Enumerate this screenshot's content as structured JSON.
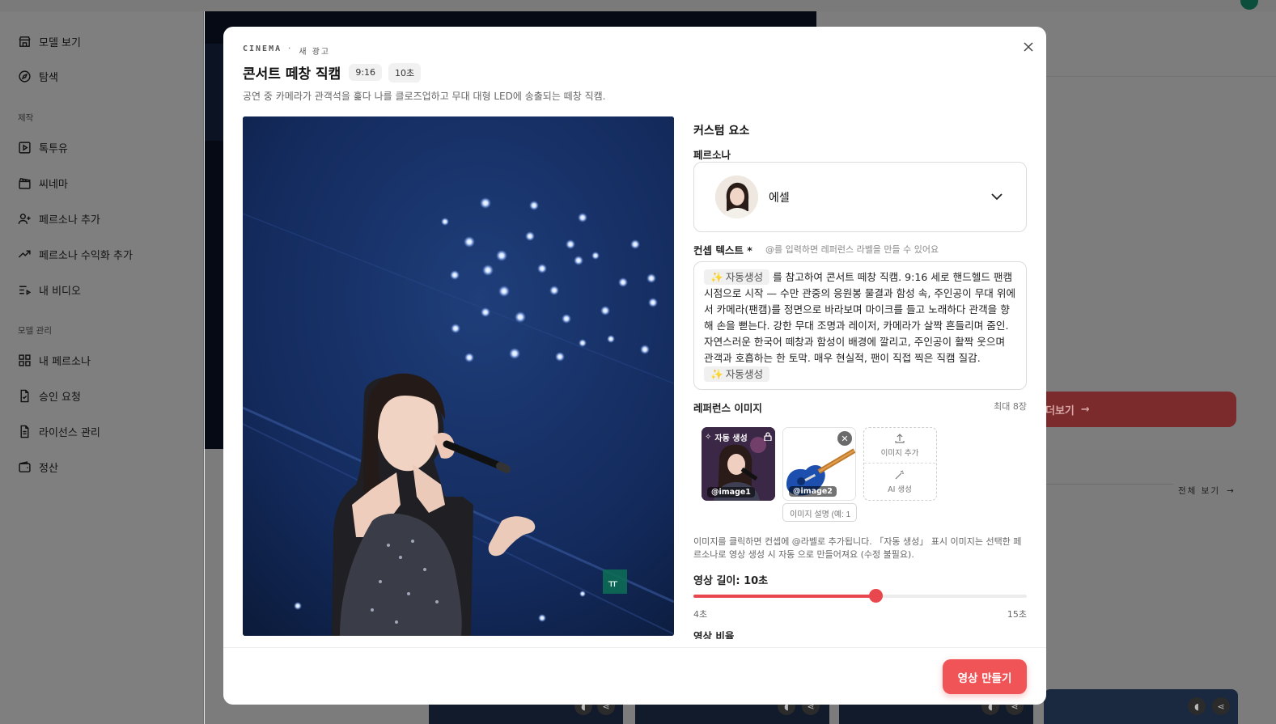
{
  "sidebar": {
    "items": [
      {
        "label": "모델 보기",
        "icon": "store-icon"
      },
      {
        "label": "탐색",
        "icon": "compass-icon"
      },
      {
        "label": "톡투유",
        "icon": "play-square-icon"
      },
      {
        "label": "씨네마",
        "icon": "clapperboard-icon"
      },
      {
        "label": "페르소나 추가",
        "icon": "user-plus-icon"
      },
      {
        "label": "페르소나 수익화 추가",
        "icon": "trending-up-icon"
      },
      {
        "label": "내 비디오",
        "icon": "list-video-icon"
      },
      {
        "label": "내 페르소나",
        "icon": "grid-icon"
      },
      {
        "label": "승인 요청",
        "icon": "file-check-icon"
      },
      {
        "label": "라이선스 관리",
        "icon": "file-text-icon"
      },
      {
        "label": "정산",
        "icon": "wallet-icon"
      }
    ],
    "sections": {
      "create": "제작",
      "model_mgmt": "모델 관리"
    }
  },
  "background": {
    "cta_label": "더보기",
    "see_all": "전체 보기"
  },
  "modal": {
    "eyebrow_category": "CINEMA",
    "eyebrow_sep": "·",
    "eyebrow_sub": "새 광고",
    "title": "콘서트 떼창 직캠",
    "ratio_chip": "9:16",
    "duration_chip": "10초",
    "description": "공연 중 카메라가 관객석을 훑다 나를 클로즈업하고 무대 대형 LED에 송출되는 떼창 직캠.",
    "close_icon": "close-icon"
  },
  "form": {
    "section_title": "커스텀 요소",
    "persona_label": "페르소나",
    "persona_name": "에셀",
    "concept_label": "컨셉 텍스트 *",
    "concept_hint": "@를 입력하면 레퍼런스 라벨을 만들 수 있어요",
    "auto_token": "자동생성",
    "concept_text": "를 참고하여 콘서트 떼창 직캠. 9:16 세로 핸드헬드 팬캠 시점으로 시작 — 수만 관중의 응원봉 물결과 함성 속, 주인공이 무대 위에서 카메라(팬캠)를 정면으로 바라보며 마이크를 들고 노래하다 관객을 향해 손을 뻗는다. 강한 무대 조명과 레이저, 카메라가 살짝 흔들리며 줌인. 자연스러운 한국어 떼창과 함성이 배경에 깔리고, 주인공이 활짝 웃으며 관객과 호흡하는 한 토막. 매우 현실적, 팬이 직접 찍은 직캠 질감.",
    "ref_label": "레퍼런스 이미지",
    "ref_max": "최대 8장",
    "ref_images": [
      {
        "label": "@image1",
        "badge": "자동 생성"
      },
      {
        "label": "@image2"
      }
    ],
    "add_image": "이미지 추가",
    "ai_generate": "AI 생성",
    "img_desc_placeholder": "이미지 설명 (예: 1",
    "note": "이미지를 클릭하면 컨셉에 @라벨로 추가됩니다. 「자동 생성」 표시 이미지는 선택한 페르소나로 영상 생성 시 자동 으로 만들어져요 (수정 불필요).",
    "length_label": "영상 길이: 10초",
    "length_min": "4초",
    "length_max": "15초",
    "length_value": 10,
    "length_range": [
      4,
      15
    ],
    "ratio_label": "영상 비율"
  },
  "footer": {
    "make_button": "영상 만들기"
  },
  "colors": {
    "accent": "#f05457",
    "slider": "#e8484d"
  }
}
